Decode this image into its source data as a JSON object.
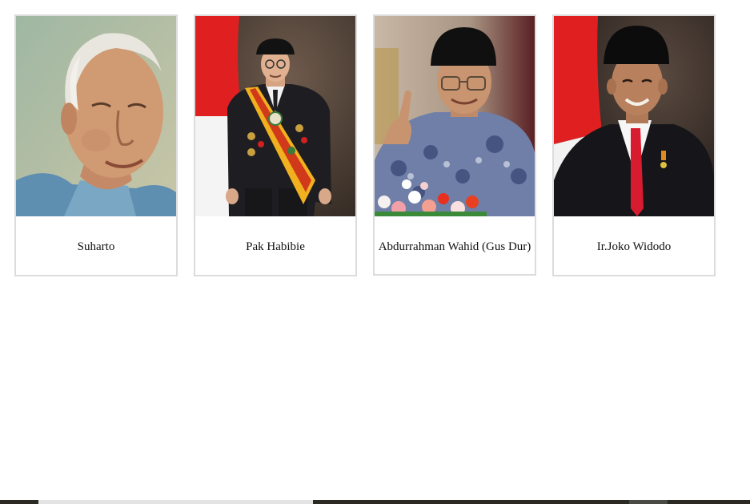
{
  "gallery": {
    "cards": [
      {
        "name": "Suharto"
      },
      {
        "name": "Pak Habibie"
      },
      {
        "name": "Abdurrahman Wahid (Gus Dur)"
      },
      {
        "name": "Ir.Joko Widodo"
      }
    ]
  },
  "colors": {
    "card_border": "#dcdcdc",
    "flag_red": "#e02020",
    "scrollbar_track": "#2a2a22",
    "scrollbar_thumb": "#e3e3e3"
  }
}
